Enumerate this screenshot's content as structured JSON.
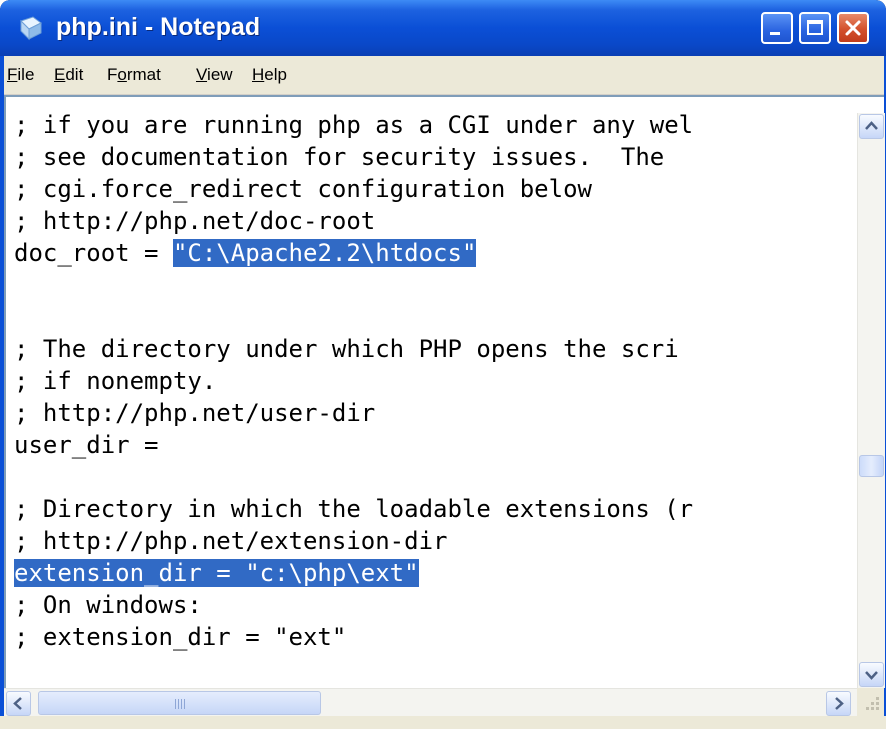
{
  "window": {
    "title": "php.ini - Notepad",
    "accent": "#0a4fd6",
    "close_color": "#d3512d",
    "selection_color": "#316ac5"
  },
  "title_icons": {
    "app_icon": "notepad-icon",
    "minimize": "minimize-icon",
    "maximize": "maximize-icon",
    "close": "close-icon"
  },
  "menu": {
    "items": [
      {
        "mnemonic": "F",
        "rest": "ile"
      },
      {
        "mnemonic": "E",
        "rest": "dit"
      },
      {
        "pre": "F",
        "mnemonic": "o",
        "rest": "rmat"
      },
      {
        "mnemonic": "V",
        "rest": "iew"
      },
      {
        "mnemonic": "H",
        "rest": "elp"
      }
    ]
  },
  "editor": {
    "lines": [
      {
        "text": "; if you are running php as a CGI under any wel"
      },
      {
        "text": "; see documentation for security issues.  The "
      },
      {
        "text": "; cgi.force_redirect configuration below"
      },
      {
        "text": "; http://php.net/doc-root"
      },
      {
        "pre": "doc_root = ",
        "sel": "\"C:\\Apache2.2\\htdocs\""
      },
      {
        "text": ""
      },
      {
        "text": ""
      },
      {
        "text": "; The directory under which PHP opens the scri"
      },
      {
        "text": "; if nonempty."
      },
      {
        "text": "; http://php.net/user-dir"
      },
      {
        "text": "user_dir ="
      },
      {
        "text": ""
      },
      {
        "text": "; Directory in which the loadable extensions (r"
      },
      {
        "text": "; http://php.net/extension-dir"
      },
      {
        "pre": "",
        "sel": "extension_dir = \"c:\\php\\ext\""
      },
      {
        "text": "; On windows:"
      },
      {
        "text": "; extension_dir = \"ext\""
      }
    ]
  },
  "scrollbars": {
    "vertical_position": 0.6,
    "horizontal_position": 0.0,
    "icons": [
      "scroll-up-icon",
      "scroll-down-icon",
      "scroll-left-icon",
      "scroll-right-icon",
      "size-grip-icon"
    ]
  }
}
